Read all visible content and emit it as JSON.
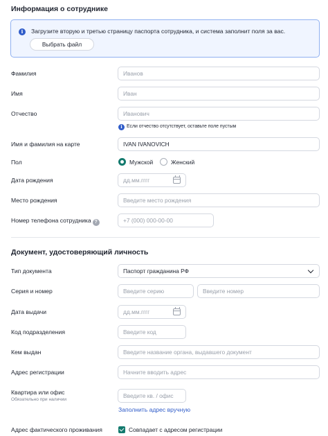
{
  "employee_section": {
    "title": "Информация о сотруднике",
    "upload_notice": "Загрузите вторую и третью страницу паспорта сотрудника, и система заполнит поля за вас.",
    "choose_file_button": "Выбрать файл",
    "last_name": {
      "label": "Фамилия",
      "placeholder": "Иванов"
    },
    "first_name": {
      "label": "Имя",
      "placeholder": "Иван"
    },
    "patronymic": {
      "label": "Отчество",
      "placeholder": "Иванович",
      "hint": "Если отчество отсутствует, оставьте поле пустым"
    },
    "card_name": {
      "label": "Имя и фамилия на карте",
      "value": "IVAN IVANOVICH"
    },
    "gender": {
      "label": "Пол",
      "options": [
        "Мужской",
        "Женский"
      ],
      "selected": "Мужской"
    },
    "birth_date": {
      "label": "Дата рождения",
      "placeholder": "дд.мм.гггг"
    },
    "birth_place": {
      "label": "Место рождения",
      "placeholder": "Введите место рождения"
    },
    "phone": {
      "label": "Номер телефона сотрудника",
      "placeholder": "+7 (000) 000-00-00",
      "help_icon": "?"
    }
  },
  "document_section": {
    "title": "Документ, удостоверяющий личность",
    "doc_type": {
      "label": "Тип документа",
      "value": "Паспорт гражданина РФ"
    },
    "series_number": {
      "label": "Серия и номер",
      "series_placeholder": "Введите серию",
      "number_placeholder": "Введите номер"
    },
    "issue_date": {
      "label": "Дата выдачи",
      "placeholder": "дд.мм.гггг"
    },
    "division_code": {
      "label": "Код подразделения",
      "placeholder": "Введите код"
    },
    "issued_by": {
      "label": "Кем выдан",
      "placeholder": "Введите название органа, выдавшего документ"
    },
    "registration_address": {
      "label": "Адрес регистрации",
      "placeholder": "Начните вводить адрес"
    },
    "apartment": {
      "label": "Квартира или офис",
      "sublabel": "Обязательно при наличии",
      "placeholder": "Введите кв. / офис"
    },
    "manual_address_link": "Заполнить адрес вручную",
    "actual_address": {
      "label": "Адрес фактического проживания",
      "checkbox_label": "Совпадает с адресом регистрации",
      "checked": true
    }
  },
  "colors": {
    "accent": "#137a6e",
    "link": "#2f5cc9",
    "info_bg": "#f0f5ff",
    "info_border": "#8fb0f0"
  },
  "icons": {
    "info": "info-icon",
    "calendar": "calendar-icon",
    "chevron": "chevron-down-icon",
    "help": "question-icon"
  }
}
